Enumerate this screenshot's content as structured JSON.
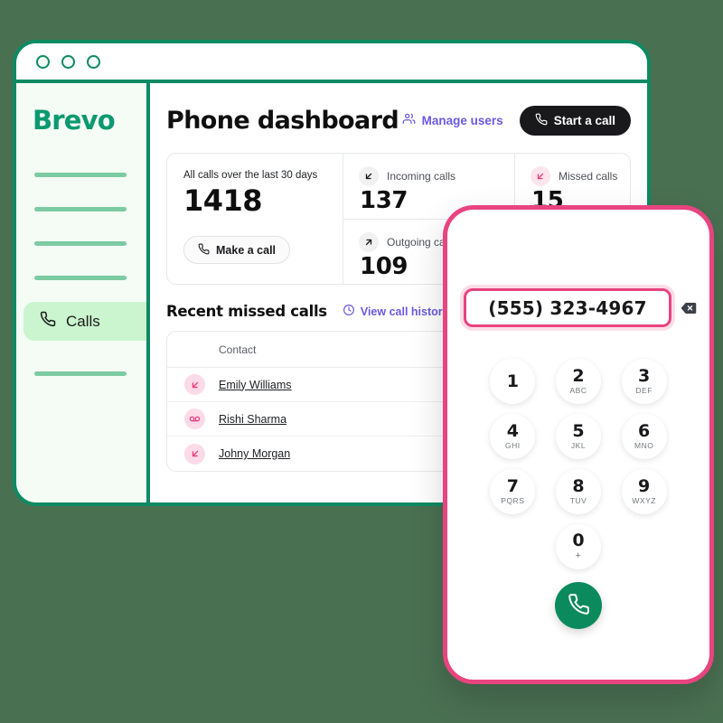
{
  "window": {
    "traffic_dots": 3
  },
  "sidebar": {
    "brand": "Brevo",
    "placeholder_items": 5,
    "active_item": {
      "label": "Calls",
      "icon": "phone-icon"
    }
  },
  "header": {
    "title": "Phone dashboard",
    "manage_users_label": "Manage users",
    "manage_users_icon": "users-icon",
    "start_call_label": "Start a call",
    "start_call_icon": "phone-icon"
  },
  "stats": {
    "all_calls_label": "All calls over the last 30 days",
    "all_calls_value": "1418",
    "make_call_label": "Make a call",
    "make_call_icon": "phone-icon",
    "cells": [
      {
        "label": "Incoming calls",
        "value": "137",
        "icon": "arrow-down-left-icon",
        "tone": "gray"
      },
      {
        "label": "Outgoing calls",
        "value": "109",
        "icon": "arrow-up-right-icon",
        "tone": "gray"
      },
      {
        "label": "Missed calls",
        "value": "15",
        "icon": "arrow-down-left-icon",
        "tone": "pink"
      }
    ]
  },
  "recent_calls": {
    "title": "Recent missed calls",
    "view_history_label": "View call history",
    "view_history_icon": "clock-icon",
    "column_header": "Contact",
    "rows": [
      {
        "name": "Emily Williams",
        "icon": "missed-call-icon"
      },
      {
        "name": "Rishi Sharma",
        "icon": "voicemail-icon"
      },
      {
        "name": "Johny Morgan",
        "icon": "missed-call-icon"
      }
    ]
  },
  "phone": {
    "number": "(555) 323-4967",
    "backspace_icon": "backspace-icon",
    "call_icon": "phone-icon",
    "keys": [
      {
        "digit": "1",
        "letters": ""
      },
      {
        "digit": "2",
        "letters": "ABC"
      },
      {
        "digit": "3",
        "letters": "DEF"
      },
      {
        "digit": "4",
        "letters": "GHI"
      },
      {
        "digit": "5",
        "letters": "JKL"
      },
      {
        "digit": "6",
        "letters": "MNO"
      },
      {
        "digit": "7",
        "letters": "PQRS"
      },
      {
        "digit": "8",
        "letters": "TUV"
      },
      {
        "digit": "9",
        "letters": "WXYZ"
      }
    ],
    "zero_key": {
      "digit": "0",
      "letters": "+"
    }
  },
  "colors": {
    "page_background": "#4a7052",
    "frame_green": "#0e8a63",
    "brand_green": "#0b9970",
    "sidebar_bg": "#f4fcf5",
    "sidebar_active": "#cbf5ce",
    "accent_purple": "#6a5ae0",
    "accent_pink": "#e8447f",
    "call_green": "#0b8a5e",
    "dark_button": "#19191c"
  }
}
